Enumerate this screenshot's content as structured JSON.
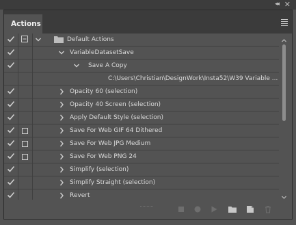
{
  "window": {
    "collapse_glyph": "◂◂",
    "close_glyph": "✕"
  },
  "panel": {
    "tab_label": "Actions",
    "menu_icon": "hamburger-menu-icon"
  },
  "rows": [
    {
      "checked": true,
      "dialog": "dialog-icon",
      "arrow": "chevron-down-icon",
      "folder": true,
      "label": "Default Actions"
    },
    {
      "checked": true,
      "dialog": "",
      "arrow": "chevron-down-icon",
      "folder": false,
      "label": "VariableDatasetSave"
    },
    {
      "checked": true,
      "dialog": "",
      "arrow": "chevron-down-icon",
      "folder": false,
      "label": "Save A Copy"
    },
    {
      "checked": null,
      "dialog": "",
      "arrow": "",
      "folder": false,
      "label": "C:\\Users\\Christian\\DesignWork\\Insta52\\W39 Variable ..."
    },
    {
      "checked": true,
      "dialog": "",
      "arrow": "chevron-right-icon",
      "folder": false,
      "label": "Opacity 60 (selection)"
    },
    {
      "checked": true,
      "dialog": "",
      "arrow": "chevron-right-icon",
      "folder": false,
      "label": "Opacity 40 Screen (selection)"
    },
    {
      "checked": true,
      "dialog": "",
      "arrow": "chevron-right-icon",
      "folder": false,
      "label": "Apply Default Style (selection)"
    },
    {
      "checked": true,
      "dialog": "box",
      "arrow": "chevron-right-icon",
      "folder": false,
      "label": "Save For Web GIF 64 Dithered"
    },
    {
      "checked": true,
      "dialog": "box",
      "arrow": "chevron-right-icon",
      "folder": false,
      "label": "Save For Web JPG Medium"
    },
    {
      "checked": true,
      "dialog": "box",
      "arrow": "chevron-right-icon",
      "folder": false,
      "label": "Save For Web PNG 24"
    },
    {
      "checked": true,
      "dialog": "",
      "arrow": "chevron-right-icon",
      "folder": false,
      "label": "Simplify (selection)"
    },
    {
      "checked": true,
      "dialog": "",
      "arrow": "chevron-right-icon",
      "folder": false,
      "label": "Simplify Straight (selection)"
    },
    {
      "checked": true,
      "dialog": "",
      "arrow": "chevron-right-icon",
      "folder": false,
      "label": "Revert"
    }
  ],
  "bottom_icons": [
    "stop-recording-icon",
    "begin-recording-icon",
    "play-selection-icon",
    "new-set-icon",
    "new-action-icon",
    "delete-icon"
  ],
  "colors": {
    "background": "#535353",
    "tab_bar": "#3b3b3b",
    "text": "#dcdcdc"
  }
}
